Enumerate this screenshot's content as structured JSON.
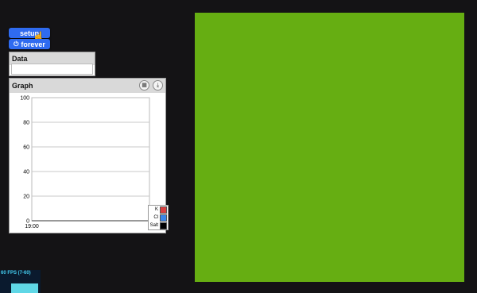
{
  "buttons": {
    "setup": "setup",
    "forever": "forever"
  },
  "data_panel": {
    "title": "Data",
    "value": ""
  },
  "graph_panel": {
    "title": "Graph"
  },
  "chart_data": {
    "type": "line",
    "title": "",
    "xlabel": "",
    "ylabel": "",
    "x_tick_labels": [
      "19:00"
    ],
    "y_ticks": [
      0,
      20,
      40,
      60,
      80,
      100
    ],
    "ylim": [
      0,
      100
    ],
    "grid": true,
    "legend_position": "bottom-right",
    "series": [
      {
        "name": "K",
        "color": "#d94040",
        "values": []
      },
      {
        "name": "Cl",
        "color": "#3a86e8",
        "values": []
      },
      {
        "name": "Salt",
        "color": "#000000",
        "values": []
      }
    ]
  },
  "stage": {
    "color": "#66ae12"
  },
  "fps_meter": {
    "label": "60 FPS (7-60)"
  }
}
